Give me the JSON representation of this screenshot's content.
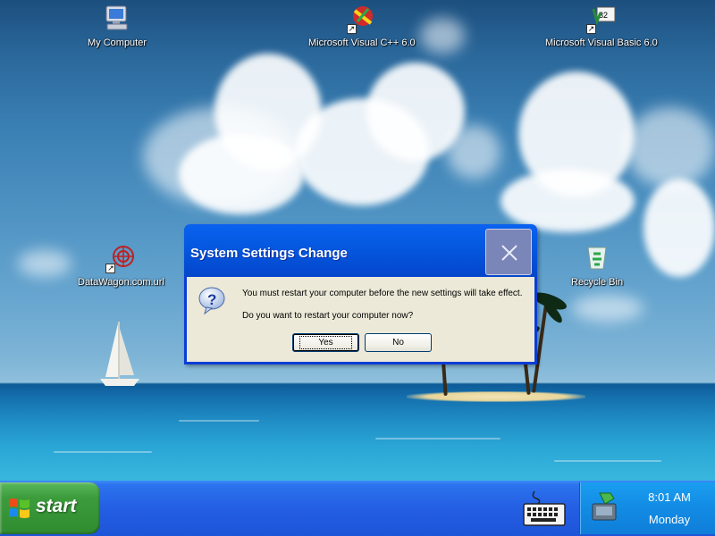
{
  "desktop": {
    "icons": [
      {
        "label": "My Computer",
        "icon": "my-computer-icon"
      },
      {
        "label": "Microsoft Visual C++ 6.0",
        "icon": "visual-cpp-icon"
      },
      {
        "label": "Microsoft Visual Basic 6.0",
        "icon": "visual-basic-icon"
      },
      {
        "label": "DataWagon.com.url",
        "icon": "internet-shortcut-icon"
      },
      {
        "label": "Recycle Bin",
        "icon": "recycle-bin-icon"
      }
    ]
  },
  "dialog": {
    "title": "System Settings Change",
    "message_1": "You must restart your computer before the new settings will take effect.",
    "message_2": "Do you want to restart your computer now?",
    "yes_label": "Yes",
    "no_label": "No",
    "icon": "question-icon"
  },
  "taskbar": {
    "start_label": "start",
    "time": "8:01 AM",
    "day": "Monday"
  },
  "colors": {
    "titlebar": "#0559e0",
    "dialog_bg": "#ece9d8",
    "taskbar": "#245ee3",
    "start_button": "#3c9c3c",
    "tray": "#128be4"
  }
}
